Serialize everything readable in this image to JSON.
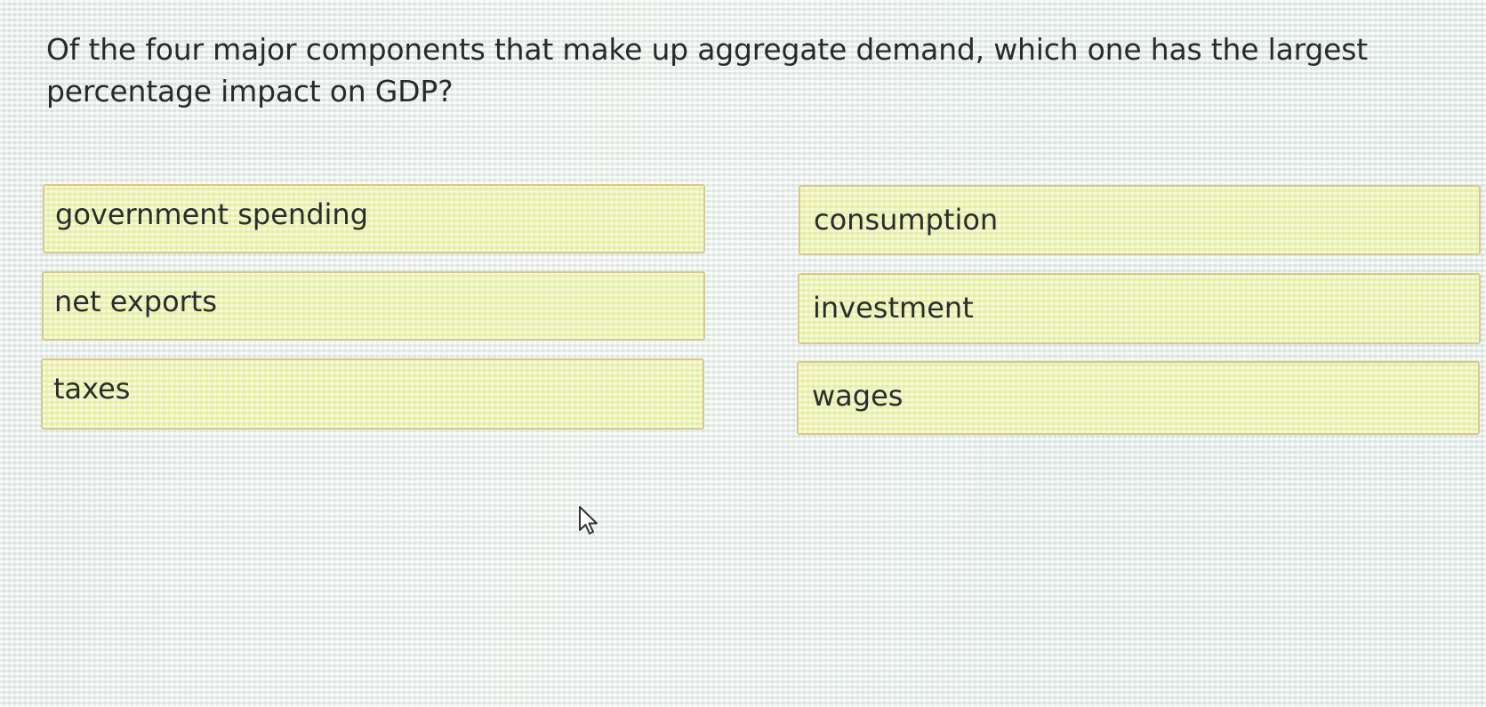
{
  "question": {
    "text": "Of the four major components that make up aggregate demand, which one has the largest percentage impact on GDP?"
  },
  "choices": [
    {
      "label": "government spending"
    },
    {
      "label": "consumption"
    },
    {
      "label": "net exports"
    },
    {
      "label": "investment"
    },
    {
      "label": "taxes"
    },
    {
      "label": "wages"
    }
  ],
  "colors": {
    "choice_fill": "#eef2b4",
    "choice_border": "#d8c98a",
    "text": "#2b2b2b"
  },
  "icons": {
    "cursor": "mouse-pointer-icon"
  }
}
